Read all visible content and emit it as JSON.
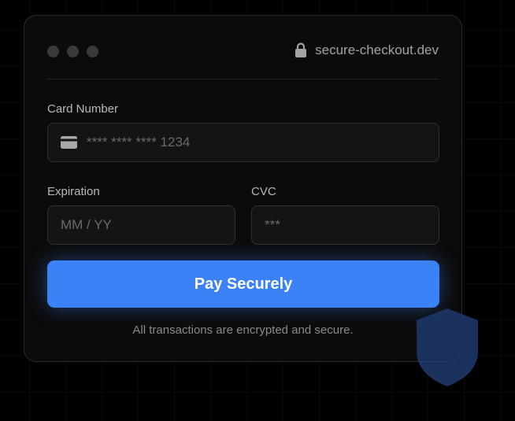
{
  "window": {
    "url": "secure-checkout.dev",
    "icons": {
      "lock": "lock-icon",
      "card": "credit-card-icon",
      "shield": "shield-icon"
    }
  },
  "form": {
    "card_number": {
      "label": "Card Number",
      "placeholder": "**** **** **** 1234"
    },
    "expiration": {
      "label": "Expiration",
      "placeholder": "MM / YY"
    },
    "cvc": {
      "label": "CVC",
      "placeholder": "***"
    },
    "submit_label": "Pay Securely",
    "note": "All transactions are encrypted and secure."
  },
  "colors": {
    "accent": "#3b82f6",
    "background": "#000000",
    "card": "#0b0b0b",
    "shield": "#1e3a6e"
  }
}
